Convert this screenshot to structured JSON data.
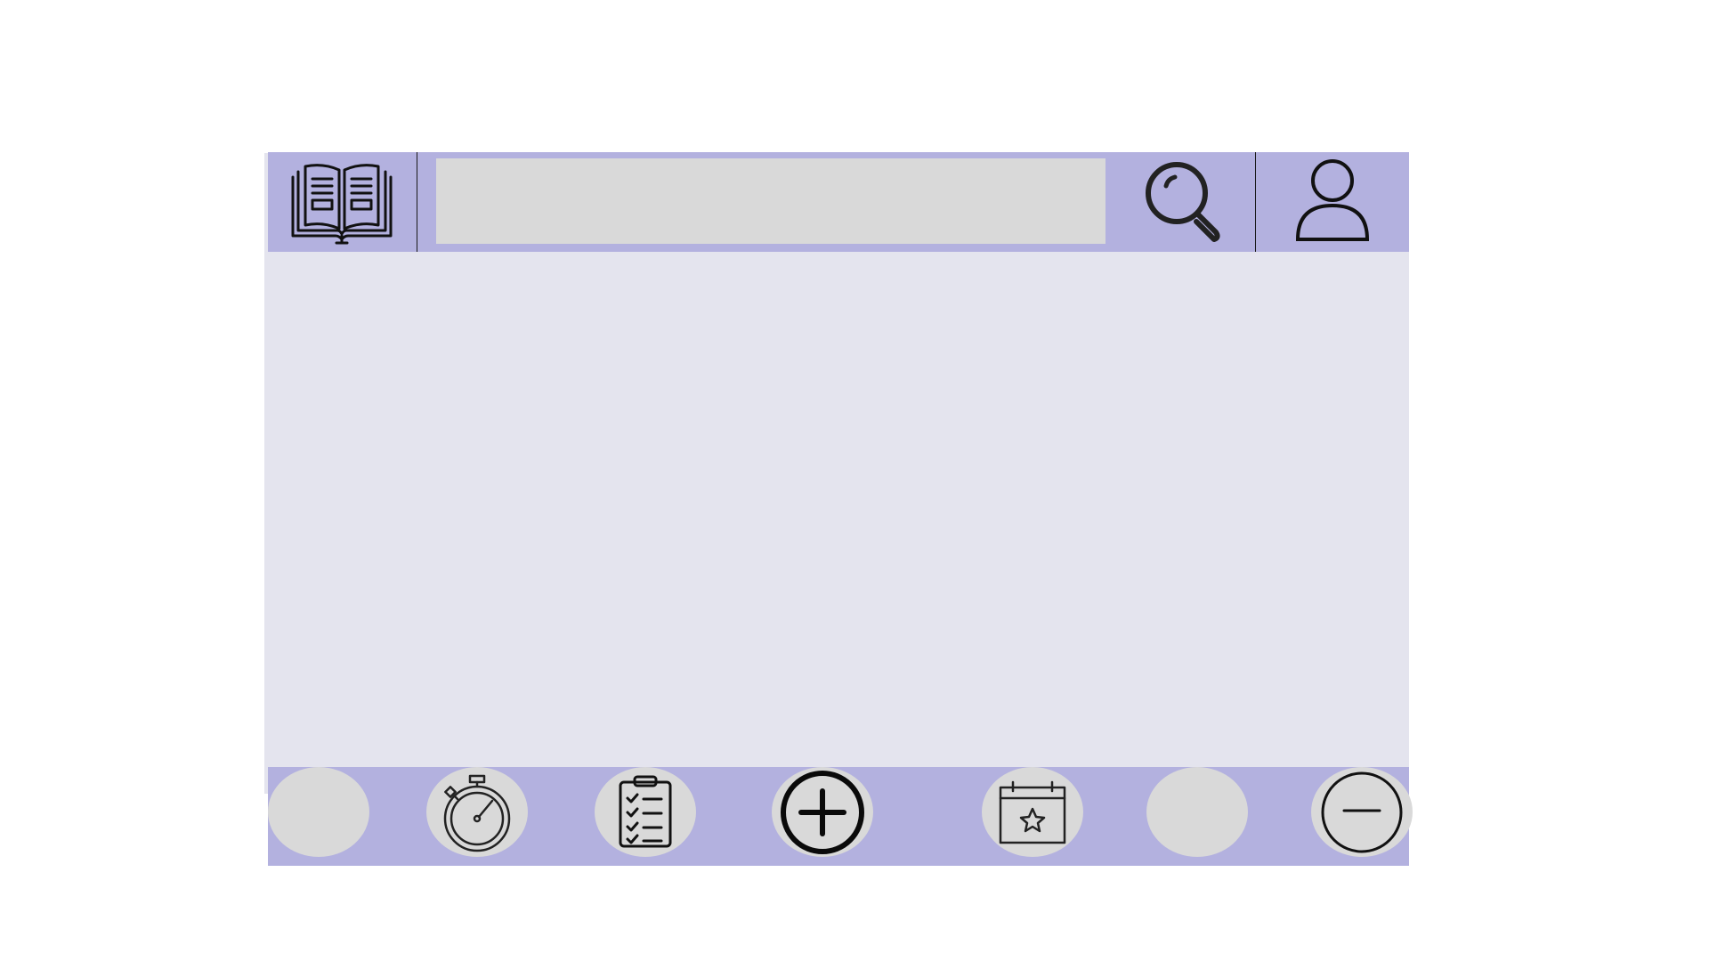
{
  "header": {
    "logo_icon": "open-book-icon",
    "search": {
      "value": "",
      "placeholder": ""
    },
    "search_icon": "magnifier-icon",
    "profile_icon": "user-icon"
  },
  "bottom_nav": {
    "items": [
      {
        "icon": ""
      },
      {
        "icon": "stopwatch-icon"
      },
      {
        "icon": "checklist-icon"
      },
      {
        "icon": "add-circle-icon"
      },
      {
        "icon": "calendar-star-icon"
      },
      {
        "icon": ""
      },
      {
        "icon": "minus-circle-icon"
      }
    ]
  },
  "colors": {
    "bar_background": "#b3b1df",
    "content_background": "#e4e4ee",
    "control_fill": "#d9d9d9",
    "icon_stroke": "#111111"
  }
}
